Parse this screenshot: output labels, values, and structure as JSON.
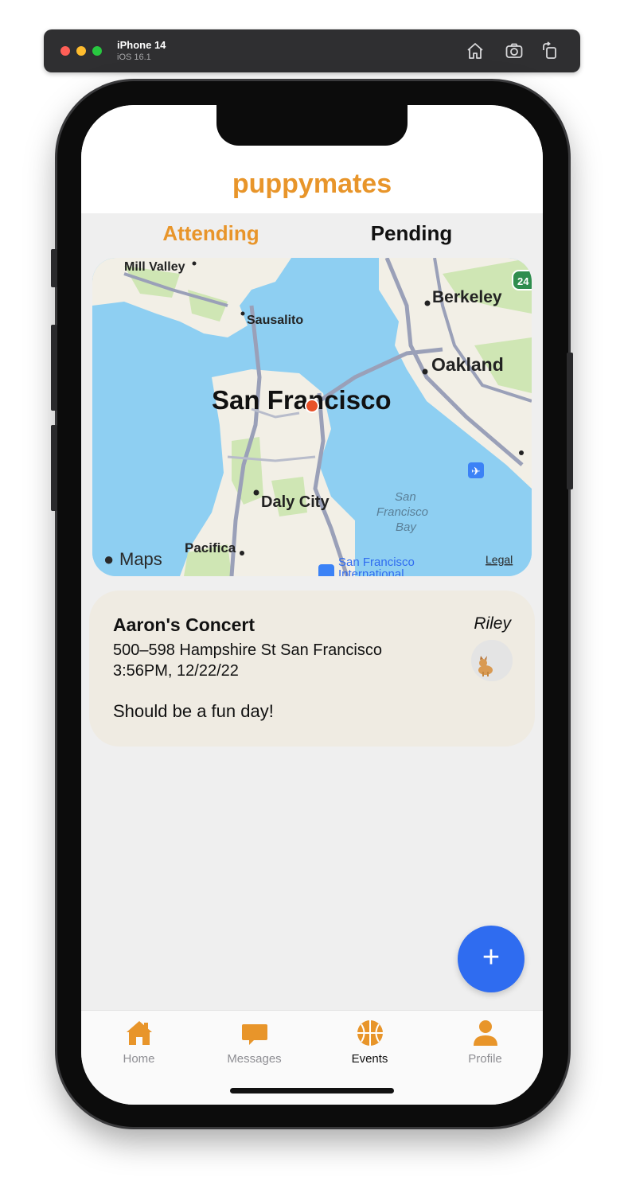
{
  "simulator": {
    "device": "iPhone 14",
    "os": "iOS 16.1",
    "icons": [
      "home-icon",
      "screenshot-icon",
      "rotate-icon"
    ]
  },
  "app": {
    "title": "puppymates"
  },
  "tabs": [
    {
      "label": "Attending",
      "active": true
    },
    {
      "label": "Pending",
      "active": false
    }
  ],
  "map": {
    "labels": {
      "mill_valley": "Mill Valley",
      "sausalito": "Sausalito",
      "berkeley": "Berkeley",
      "oakland": "Oakland",
      "san_francisco": "San Francisco",
      "daly_city": "Daly City",
      "sf_bay_1": "San",
      "sf_bay_2": "Francisco",
      "sf_bay_3": "Bay",
      "pacifica": "Pacifica",
      "airport_1": "San Francisco",
      "airport_2": "International",
      "highway": "24",
      "brand": "Maps",
      "legal": "Legal"
    }
  },
  "event": {
    "title": "Aaron's Concert",
    "address": "500–598 Hampshire St San Francisco",
    "datetime": "3:56PM, 12/22/22",
    "description": "Should be a fun day!",
    "host": "Riley"
  },
  "fab": {
    "label": "+"
  },
  "tabbar": [
    {
      "label": "Home",
      "icon": "house-icon",
      "active": false
    },
    {
      "label": "Messages",
      "icon": "message-icon",
      "active": false
    },
    {
      "label": "Events",
      "icon": "basketball-icon",
      "active": true
    },
    {
      "label": "Profile",
      "icon": "person-icon",
      "active": false
    }
  ],
  "colors": {
    "accent": "#e8952a",
    "fab": "#2f6cf0",
    "card": "#efebe2",
    "background": "#efefef"
  }
}
